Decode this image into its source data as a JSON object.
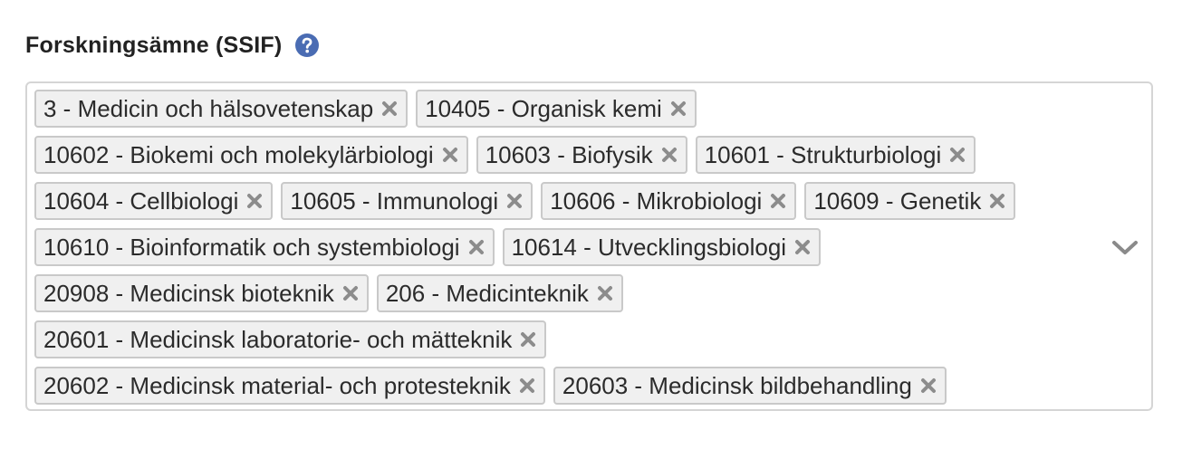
{
  "field": {
    "label": "Forskningsämne (SSIF)",
    "help_icon": "question-circle-icon",
    "dropdown_icon": "chevron-down-icon",
    "colors": {
      "help": "#4a6cb3",
      "chip_bg": "#f0f0f0",
      "chip_border": "#c9c9c9",
      "remove_icon": "#8c8c8c",
      "chevron": "#8a8a8a"
    }
  },
  "chips": {
    "rows": [
      [
        "3 - Medicin och hälsovetenskap",
        "10405 - Organisk kemi"
      ],
      [
        "10602 - Biokemi och molekylärbiologi",
        "10603 - Biofysik",
        "10601 - Strukturbiologi"
      ],
      [
        "10604 - Cellbiologi",
        "10605 - Immunologi",
        "10606 - Mikrobiologi",
        "10609 - Genetik"
      ],
      [
        "10610 - Bioinformatik och systembiologi",
        "10614 - Utvecklingsbiologi"
      ],
      [
        "20908 - Medicinsk bioteknik",
        "206 - Medicinteknik"
      ],
      [
        "20601 - Medicinsk laboratorie- och mätteknik"
      ],
      [
        "20602 - Medicinsk material- och protesteknik",
        "20603 - Medicinsk bildbehandling"
      ]
    ],
    "remove_icon": "close-x-icon"
  }
}
